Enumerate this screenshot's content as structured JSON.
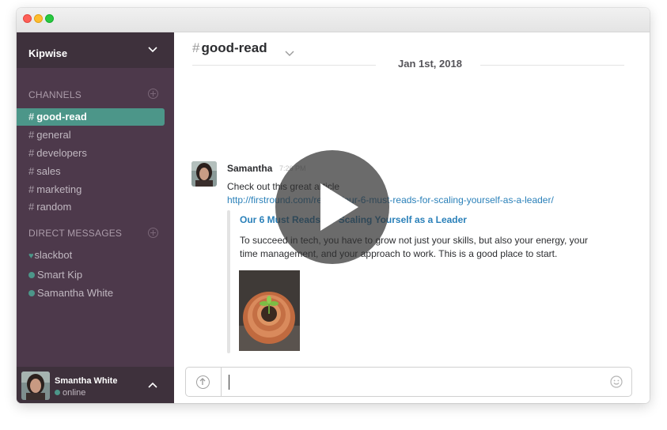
{
  "team": {
    "name": "Kipwise"
  },
  "sections": {
    "channels_title": "CHANNELS",
    "dms_title": "DIRECT MESSAGES"
  },
  "channels": [
    {
      "hash": "#",
      "name": "good-read",
      "active": true
    },
    {
      "hash": "#",
      "name": "general"
    },
    {
      "hash": "#",
      "name": "developers"
    },
    {
      "hash": "#",
      "name": "sales"
    },
    {
      "hash": "#",
      "name": "marketing"
    },
    {
      "hash": "#",
      "name": "random"
    }
  ],
  "direct_messages": [
    {
      "name": "slackbot",
      "icon": "heart-icon"
    },
    {
      "name": "Smart Kip",
      "icon": "presence-dot"
    },
    {
      "name": "Samantha White",
      "icon": "presence-dot"
    }
  ],
  "current_user": {
    "name": "Smantha White",
    "status": "online"
  },
  "header": {
    "hash": "#",
    "channel": "good-read"
  },
  "date_divider": "Jan 1st, 2018",
  "message": {
    "author": "Samantha",
    "time": "7:26 PM",
    "text": "Check out this great article",
    "link": "http://firstround.com/review/our-6-must-reads-for-scaling-yourself-as-a-leader/",
    "attachment": {
      "title": "Our 6 Must Reads for Scaling Yourself as a Leader",
      "body": "To succeed in tech, you have to grow not just your skills, but also your energy, your time management, and your approach to work. This is a good place to start."
    }
  },
  "composer": {
    "value": "",
    "placeholder": ""
  },
  "colors": {
    "sidebar": "#4d394b",
    "sidebar_dark": "#3e313c",
    "active_channel": "#4c9689",
    "link": "#2a80b9"
  },
  "overlay": {
    "icon": "play-icon"
  }
}
